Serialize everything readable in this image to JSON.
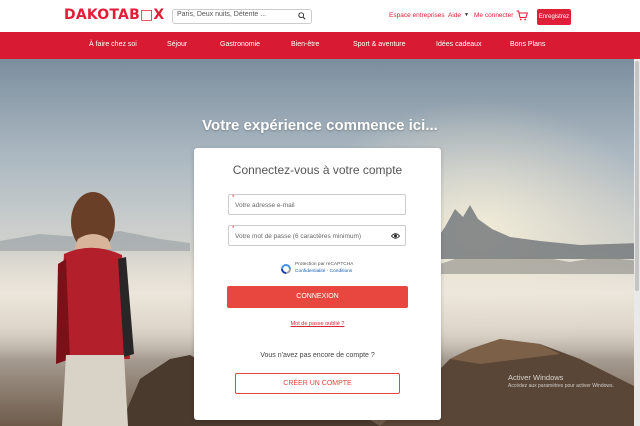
{
  "header": {
    "logo": "DAKOTAB□X",
    "search_placeholder": "Paris, Deux nuits, Détente ...",
    "links": {
      "business": "Espace entreprises",
      "help": "Aide",
      "login": "Me connecter",
      "register": "Enregistrez"
    },
    "icons": {
      "search": "search-icon",
      "cart": "cart-icon",
      "caret": "chevron-down-icon"
    }
  },
  "nav": {
    "items": [
      "À faire chez soi",
      "Séjour",
      "Gastronomie",
      "Bien-être",
      "Sport & aventure",
      "Idées cadeaux",
      "Bons Plans"
    ]
  },
  "hero": {
    "title": "Votre expérience commence ici..."
  },
  "login": {
    "title": "Connectez-vous à votre compte",
    "required_mark": "*",
    "email_placeholder": "Votre adresse e-mail",
    "password_placeholder": "Votre mot de passe (6 caractères minimum)",
    "recaptcha_line1": "Protection par reCAPTCHA",
    "recaptcha_line2": "Confidentialité - Conditions",
    "submit": "CONNEXION",
    "forgot": "Mot de passe oublié ?",
    "no_account": "Vous n'avez pas encore de compte ?",
    "create": "CRÉER UN COMPTE"
  },
  "watermark": {
    "title": "Activer Windows",
    "subtitle": "Accédez aux paramètres pour activer Windows."
  },
  "colors": {
    "brand": "#e01e37",
    "nav_bg": "#d81b33",
    "button": "#e8473f"
  }
}
